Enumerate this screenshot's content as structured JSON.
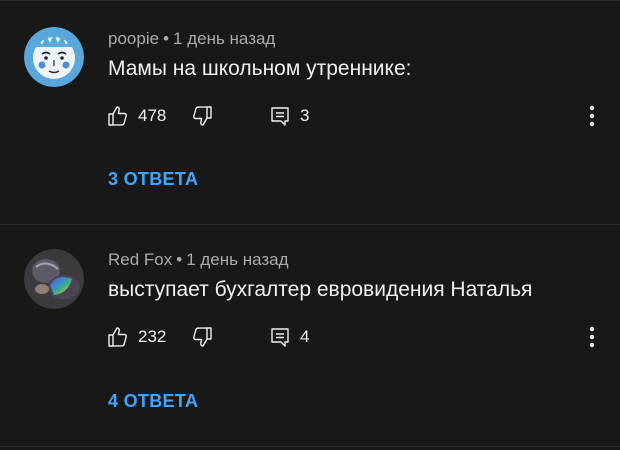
{
  "comments": [
    {
      "author": "poopie",
      "separator": "•",
      "time": "1 день назад",
      "text": "Мамы на школьном утреннике:",
      "likes": "478",
      "reply_count": "3",
      "replies_label": "3 ОТВЕТА",
      "avatar_icon": "cartoon-face-avatar"
    },
    {
      "author": "Red Fox",
      "separator": "•",
      "time": "1 день назад",
      "text": "выступает бухгалтер евровидения Наталья",
      "likes": "232",
      "reply_count": "4",
      "replies_label": "4 ОТВЕТА",
      "avatar_icon": "photo-avatar"
    }
  ],
  "colors": {
    "background": "#181818",
    "text": "#f1f1f1",
    "meta": "#aaaaaa",
    "link": "#3ea6ff"
  }
}
